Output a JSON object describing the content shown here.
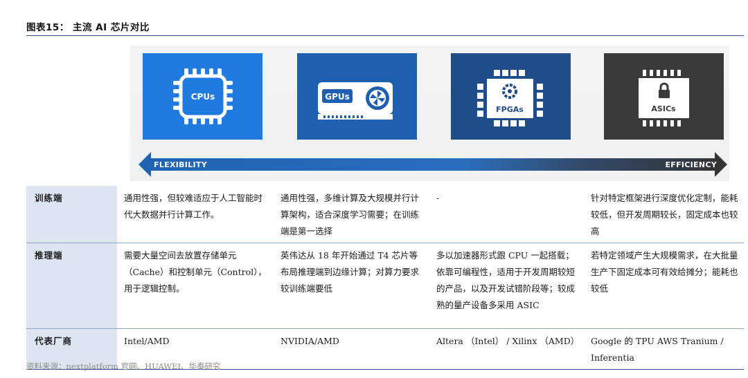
{
  "title": "图表15： 主流 AI 芯片对比",
  "banner": {
    "chips": [
      {
        "label": "CPUs",
        "color": "#1f7be0",
        "icon": "cpu-chip-icon"
      },
      {
        "label": "GPUs",
        "color": "#1f5fb0",
        "icon": "gpu-card-icon"
      },
      {
        "label": "FPGAs",
        "color": "#1f4d8a",
        "icon": "fpga-chip-icon"
      },
      {
        "label": "ASICs",
        "color": "#3a3a3a",
        "icon": "asic-lock-chip-icon"
      }
    ],
    "arrow_left": "FLEXIBILITY",
    "arrow_right": "EFFICIENCY"
  },
  "table": {
    "rows": [
      {
        "header": "训练端",
        "cells": [
          "通用性强，但较难适应于人工智能时代大数据并行计算工作。",
          "通用性强，多维计算及大规模并行计算架构，适合深度学习需要；在训练端是第一选择",
          "-",
          "针对特定框架进行深度优化定制，能耗较低，但开发周期较长，固定成本也较高"
        ]
      },
      {
        "header": "推理端",
        "cells": [
          "需要大量空间去放置存储单元（Cache）和控制单元（Control），用于逻辑控制。",
          "英伟达从 18 年开始通过 T4 芯片等布局推理端到边缘计算；对算力要求较训练端要低",
          "多以加速器形式跟 CPU 一起搭载；依靠可编程性，适用于开发周期较短的产品，以及开发试错阶段等；较成熟的量产设备多采用 ASIC",
          "若特定领域产生大规模需求，在大批量生产下固定成本可有效给摊分；能耗也较低"
        ]
      },
      {
        "header": "代表厂商",
        "cells": [
          "Intel/AMD",
          "NVIDIA/AMD",
          "Altera （Intel） / Xilinx （AMD）",
          "Google 的 TPU AWS Tranium / Inferentia"
        ]
      }
    ]
  },
  "source": "资料来源：nextplatform 官网、HUAWEI、华泰研究"
}
